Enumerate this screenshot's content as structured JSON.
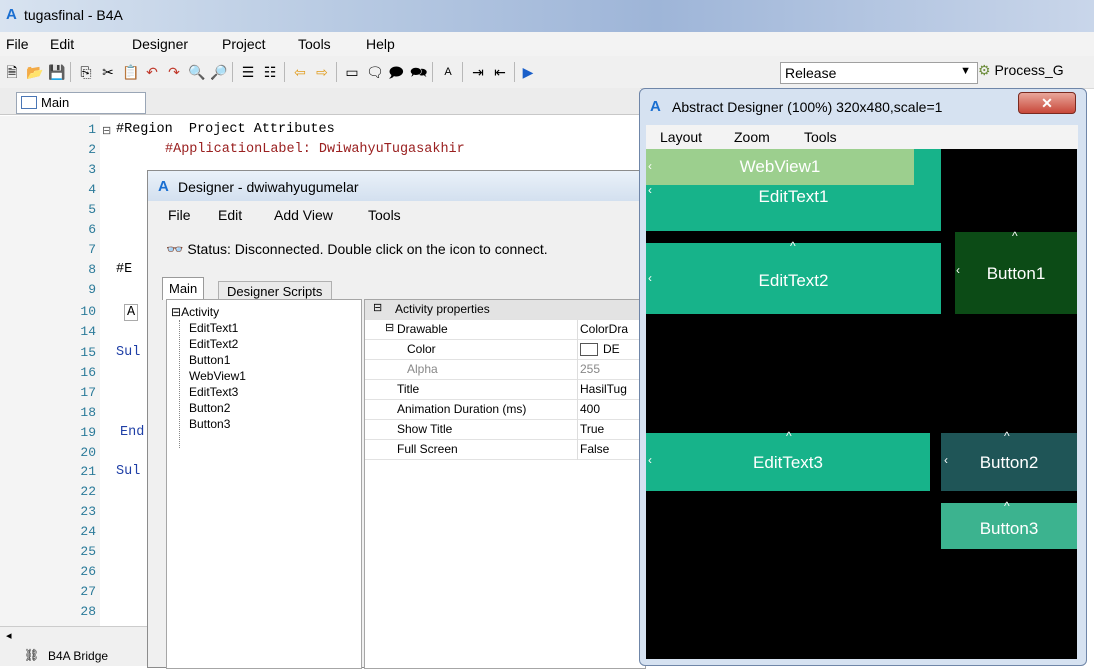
{
  "window": {
    "title": "tugasfinal - B4A"
  },
  "menu": [
    "File",
    "Edit",
    "Designer",
    "Project",
    "Tools",
    "Help"
  ],
  "toolbar": {
    "build_mode": "Release",
    "process": "Process_G"
  },
  "editor": {
    "tab": "Main",
    "line_numbers": [
      "1",
      "2",
      "3",
      "4",
      "5",
      "6",
      "7",
      "8",
      "9",
      "10",
      "14",
      "15",
      "16",
      "17",
      "18",
      "19",
      "20",
      "21",
      "22",
      "23",
      "24",
      "25",
      "26",
      "27",
      "28"
    ],
    "code": {
      "l1": "#Region  Project Attributes",
      "l2": "#ApplicationLabel: DwiwahyuTugasakhir",
      "l8": "#E",
      "l10": "A",
      "l15": "Sul",
      "l19": "End",
      "l21": "Sul"
    },
    "status": "B4A Bridge"
  },
  "designer": {
    "title": "Designer - dwiwahyugumelar",
    "menu": [
      "File",
      "Edit",
      "Add View",
      "Tools"
    ],
    "status": "Status: Disconnected. Double click on the icon to connect.",
    "tabs": [
      "Main",
      "Designer Scripts"
    ],
    "tree": {
      "root": "Activity",
      "children": [
        "EditText1",
        "EditText2",
        "Button1",
        "WebView1",
        "EditText3",
        "Button2",
        "Button3"
      ]
    },
    "properties": {
      "header": "Activity properties",
      "rows": [
        {
          "key": "Drawable",
          "value": "ColorDra"
        },
        {
          "key": "Color",
          "value": "DE"
        },
        {
          "key": "Alpha",
          "value": "255"
        },
        {
          "key": "Title",
          "value": "HasilTug"
        },
        {
          "key": "Animation Duration (ms)",
          "value": "400"
        },
        {
          "key": "Show Title",
          "value": "True"
        },
        {
          "key": "Full Screen",
          "value": "False"
        }
      ]
    }
  },
  "abstract": {
    "title": "Abstract Designer (100%) 320x480,scale=1",
    "menu": [
      "Layout",
      "Zoom",
      "Tools"
    ],
    "views": {
      "webview1": "WebView1",
      "edittext1": "EditText1",
      "edittext2": "EditText2",
      "button1": "Button1",
      "edittext3": "EditText3",
      "button2": "Button2",
      "button3": "Button3"
    },
    "colors": {
      "edittext": "#17b38a",
      "webview": "#9ccf8e",
      "button1": "#0c4b16",
      "button2": "#1f5557",
      "button3": "#3cb38f"
    }
  }
}
